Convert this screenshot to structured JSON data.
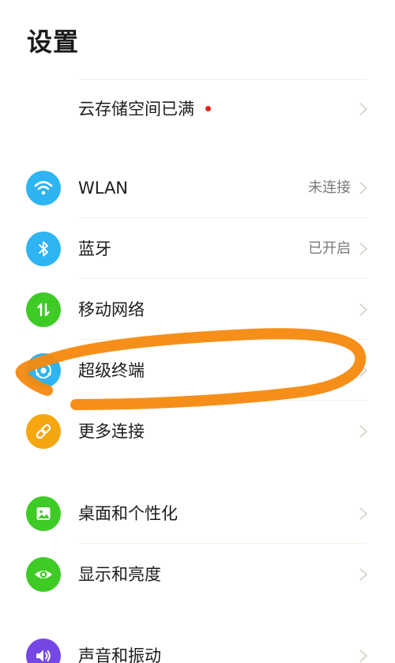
{
  "page": {
    "title": "设置"
  },
  "cloud": {
    "label": "云存储空间已满",
    "dot_color": "#E0281F"
  },
  "items": [
    {
      "label": "WLAN",
      "value": "未连接",
      "icon": "wifi-icon",
      "color": "#2DB4F2"
    },
    {
      "label": "蓝牙",
      "value": "已开启",
      "icon": "bluetooth-icon",
      "color": "#2DB4F2"
    },
    {
      "label": "移动网络",
      "value": "",
      "icon": "mobile-data-icon",
      "color": "#3ECB26"
    },
    {
      "label": "超级终端",
      "value": "",
      "icon": "super-device-icon",
      "color": "#2DB4F2"
    },
    {
      "label": "更多连接",
      "value": "",
      "icon": "link-icon",
      "color": "#F6A60E"
    },
    {
      "label": "桌面和个性化",
      "value": "",
      "icon": "wallpaper-icon",
      "color": "#3ECB26"
    },
    {
      "label": "显示和亮度",
      "value": "",
      "icon": "eye-icon",
      "color": "#3ECB26"
    },
    {
      "label": "声音和振动",
      "value": "",
      "icon": "speaker-icon",
      "color": "#7548E5"
    }
  ],
  "annotation": {
    "type": "hand-drawn ellipse",
    "color": "#F5890E",
    "target": "超级终端"
  }
}
